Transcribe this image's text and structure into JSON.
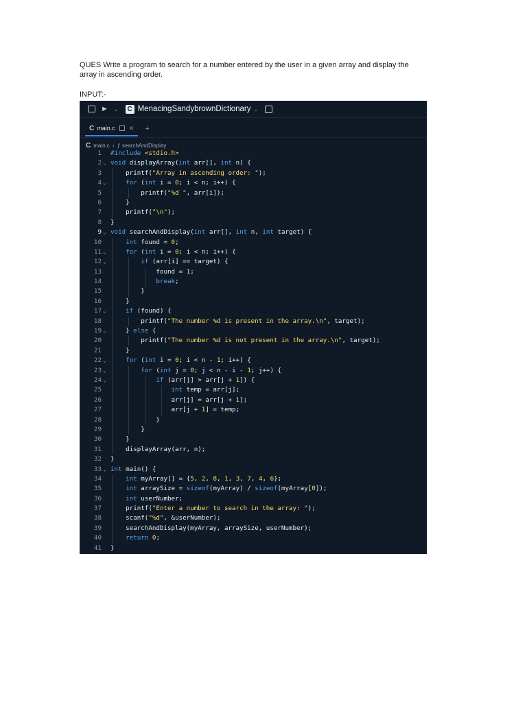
{
  "document": {
    "question": "QUES Write a program to search for a number entered by the user in a given array and display the array in ascending order.",
    "input_label": "INPUT:-"
  },
  "editor": {
    "project_name": "MenacingSandybrownDictionary",
    "tab": {
      "label": "main.c"
    },
    "breadcrumb": {
      "file": "main.c",
      "symbol": "searchAndDisplay"
    },
    "code_lines": [
      "#include <stdio.h>",
      "void displayArray(int arr[], int n) {",
      "    printf(\"Array in ascending order: \");",
      "    for (int i = 0; i < n; i++) {",
      "        printf(\"%d \", arr[i]);",
      "    }",
      "    printf(\"\\n\");",
      "}",
      "void searchAndDisplay(int arr[], int n, int target) {",
      "    int found = 0;",
      "    for (int i = 0; i < n; i++) {",
      "        if (arr[i] == target) {",
      "            found = 1;",
      "            break;",
      "        }",
      "    }",
      "    if (found) {",
      "        printf(\"The number %d is present in the array.\\n\", target);",
      "    } else {",
      "        printf(\"The number %d is not present in the array.\\n\", target);",
      "    }",
      "    for (int i = 0; i < n - 1; i++) {",
      "        for (int j = 0; j < n - i - 1; j++) {",
      "            if (arr[j] > arr[j + 1]) {",
      "                int temp = arr[j];",
      "                arr[j] = arr[j + 1];",
      "                arr[j + 1] = temp;",
      "            }",
      "        }",
      "    }",
      "    displayArray(arr, n);",
      "}",
      "int main() {",
      "    int myArray[] = {5, 2, 8, 1, 3, 7, 4, 6};",
      "    int arraySize = sizeof(myArray) / sizeof(myArray[0]);",
      "    int userNumber;",
      "    printf(\"Enter a number to search in the array: \");",
      "    scanf(\"%d\", &userNumber);",
      "    searchAndDisplay(myArray, arraySize, userNumber);",
      "    return 0;",
      "}"
    ],
    "fold_lines": [
      2,
      4,
      9,
      11,
      12,
      17,
      19,
      22,
      23,
      24,
      33
    ],
    "colors": {
      "background": "#0f1a26",
      "text": "#e6edf3",
      "keyword": "#5aa5ee",
      "string": "#ffd866",
      "number": "#ffd866",
      "comment_gutter": "#8b97a4"
    },
    "icons": [
      "sidebar-toggle-icon",
      "git-branch-icon",
      "replit-logo-icon",
      "chevron-down-icon",
      "database-icon",
      "c-file-icon",
      "close-icon",
      "add-tab-icon",
      "function-icon"
    ]
  }
}
